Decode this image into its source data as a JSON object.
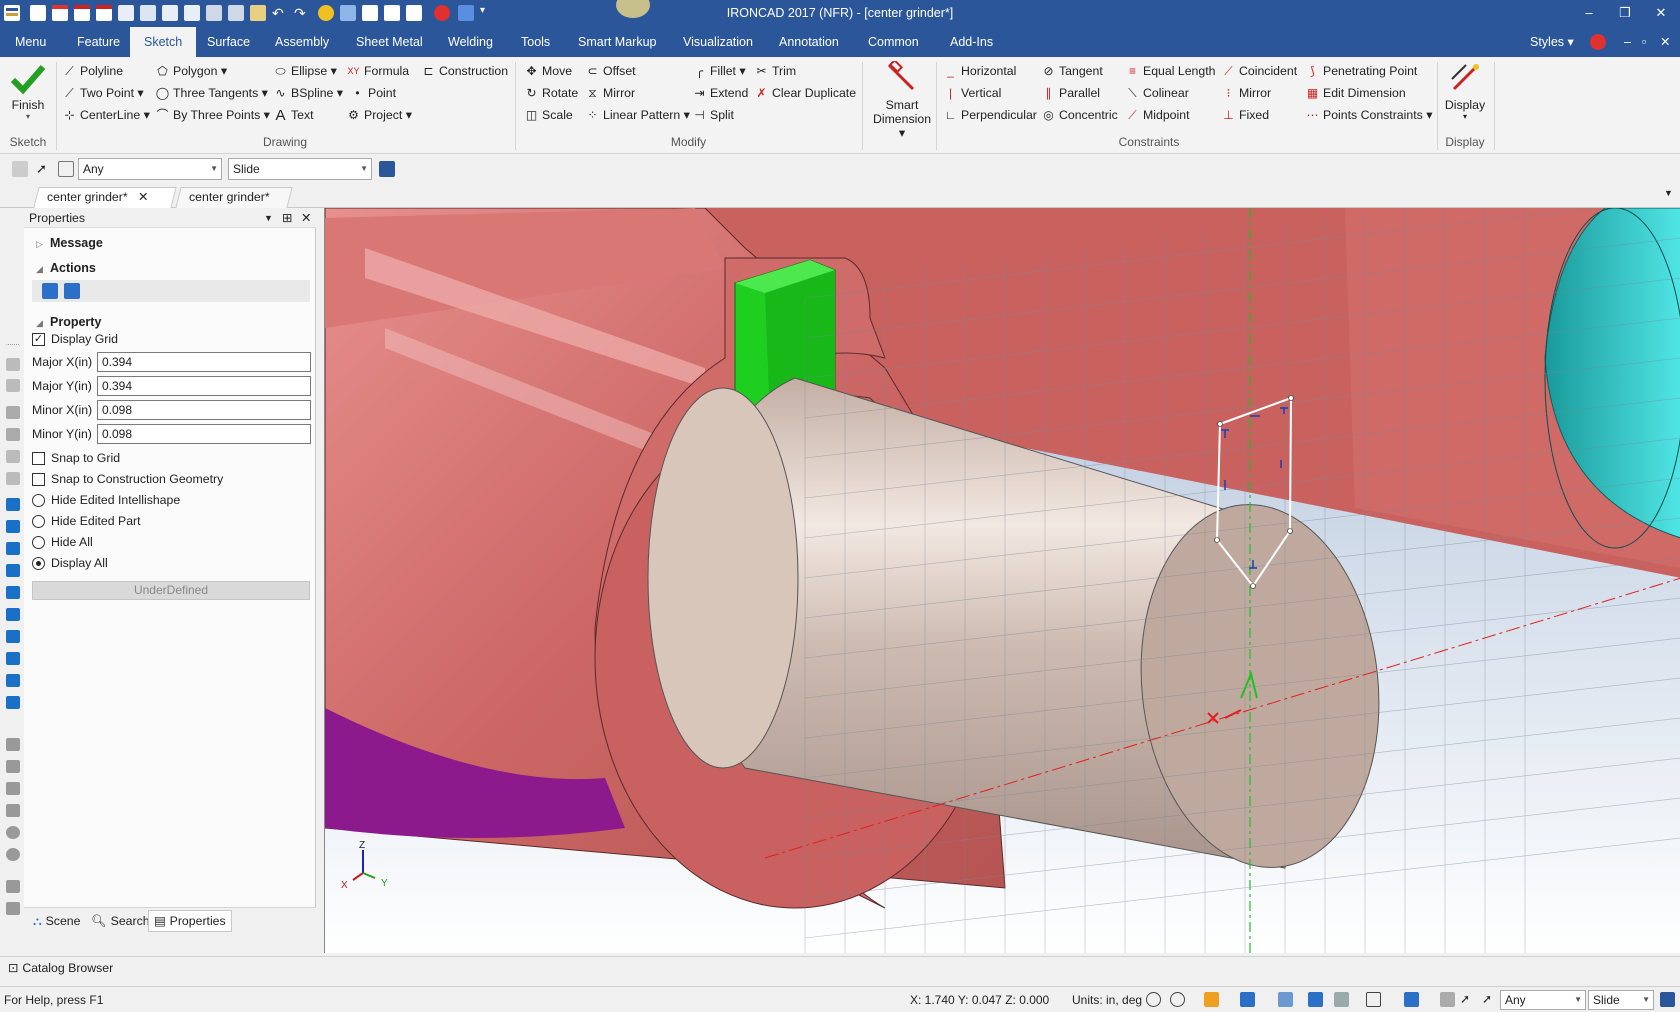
{
  "window": {
    "title": "IRONCAD 2017 (NFR) - [center grinder*]",
    "minimize": "–",
    "restore": "❐",
    "close": "✕"
  },
  "menubar": {
    "items": [
      "Menu",
      "Feature",
      "Sketch",
      "Surface",
      "Assembly",
      "Sheet Metal",
      "Welding",
      "Tools",
      "Smart Markup",
      "Visualization",
      "Annotation",
      "Common",
      "Add-Ins"
    ],
    "active": "Sketch",
    "styles": "Styles"
  },
  "ribbon": {
    "sketch_group": {
      "finish": "Finish",
      "label": "Sketch"
    },
    "drawing_group": {
      "label": "Drawing",
      "polyline": "Polyline",
      "polygon": "Polygon",
      "ellipse": "Ellipse",
      "formula": "Formula",
      "construction": "Construction",
      "two_point": "Two Point",
      "three_tangents": "Three Tangents",
      "bspline": "BSpline",
      "point": "Point",
      "centerline": "CenterLine",
      "by_three_points": "By Three Points",
      "text": "Text",
      "project": "Project"
    },
    "modify_group": {
      "label": "Modify",
      "move": "Move",
      "offset": "Offset",
      "fillet": "Fillet",
      "trim": "Trim",
      "rotate": "Rotate",
      "mirror": "Mirror",
      "extend": "Extend",
      "clear_duplicate": "Clear Duplicate",
      "scale": "Scale",
      "linear_pattern": "Linear Pattern",
      "split": "Split"
    },
    "smart_dimension": {
      "line1": "Smart",
      "line2": "Dimension"
    },
    "constraints_group": {
      "label": "Constraints",
      "horizontal": "Horizontal",
      "tangent": "Tangent",
      "equal_length": "Equal Length",
      "coincident": "Coincident",
      "penetrating_point": "Penetrating Point",
      "vertical": "Vertical",
      "parallel": "Parallel",
      "colinear": "Colinear",
      "mirror": "Mirror",
      "edit_dimension": "Edit Dimension",
      "perpendicular": "Perpendicular",
      "concentric": "Concentric",
      "midpoint": "Midpoint",
      "fixed": "Fixed",
      "points_constraints": "Points Constraints"
    },
    "display_group": {
      "button": "Display",
      "label": "Display"
    }
  },
  "toolbar2": {
    "filter_value": "Any",
    "mode_value": "Slide"
  },
  "doc_tabs": [
    "center grinder*",
    "center grinder*"
  ],
  "properties": {
    "title": "Properties",
    "message_section": "Message",
    "actions_section": "Actions",
    "property_section": "Property",
    "display_grid": "Display Grid",
    "fields": [
      {
        "label": "Major X(in)",
        "value": "0.394"
      },
      {
        "label": "Major Y(in)",
        "value": "0.394"
      },
      {
        "label": "Minor X(in)",
        "value": "0.098"
      },
      {
        "label": "Minor Y(in)",
        "value": "0.098"
      }
    ],
    "snap_to_grid": "Snap to Grid",
    "snap_to_construction": "Snap to Construction Geometry",
    "radios": [
      "Hide Edited Intellishape",
      "Hide Edited Part",
      "Hide All",
      "Display All"
    ],
    "selected_radio": "Display All",
    "status_button": "UnderDefined",
    "bottom_tabs": [
      "Scene",
      "Search",
      "Properties"
    ]
  },
  "catalog_browser": "Catalog Browser",
  "statusbar": {
    "help": "For Help, press F1",
    "coords": "X: 1.740 Y: 0.047 Z: 0.000",
    "units": "Units: in, deg",
    "filter_value": "Any",
    "mode_value": "Slide"
  },
  "axis_triad": {
    "z": "Z",
    "x": "X",
    "y": "Y"
  },
  "colors": {
    "title_bar": "#2b579a",
    "housing": "#cd6b6b",
    "shaft": "#c9b8ad",
    "key": "#1fcf1f",
    "cyan_part": "#2ed3d3",
    "purple_part": "#8c1a8c"
  }
}
